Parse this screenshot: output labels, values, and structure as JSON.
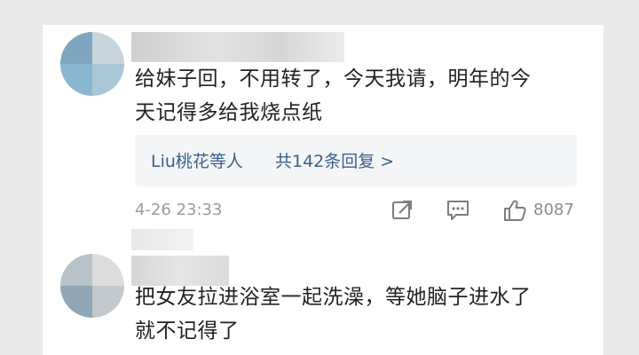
{
  "comments": [
    {
      "text_line1": "给妹子回，不用转了，今天我请，明年的今",
      "text_line2": "天记得多给我烧点纸",
      "replies_prefix": "Liu桃花等人",
      "replies_count": "共142条回复 >",
      "timestamp": "4-26 23:33",
      "likes": "8087"
    },
    {
      "text_line1": "把女友拉进浴室一起洗澡，等她脑子进水了",
      "text_line2": "就不记得了"
    }
  ],
  "icons": {
    "share": "share-icon",
    "comment": "comment-icon",
    "like": "thumbs-up-icon"
  }
}
